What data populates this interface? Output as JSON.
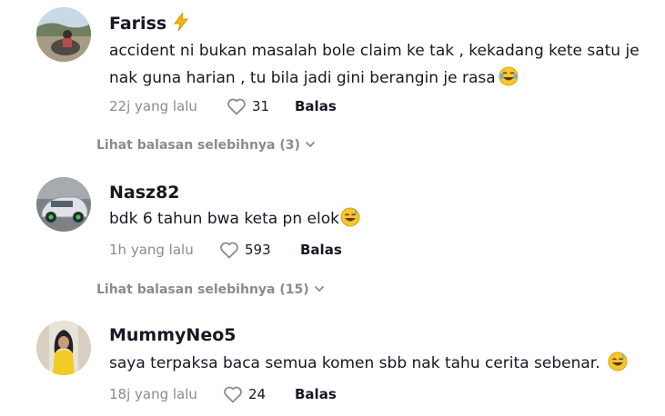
{
  "comments": [
    {
      "username": "Fariss",
      "text": "accident ni bukan masalah bole claim ke tak , kekadang kete satu je nak guna harian , tu bila jadi gini berangin je rasa",
      "time": "22j yang lalu",
      "likes": "31",
      "reply_label": "Balas",
      "more_replies": "Lihat balasan selebihnya (3)"
    },
    {
      "username": "Nasz82",
      "text": "bdk 6 tahun bwa keta pn elok",
      "time": "1h yang lalu",
      "likes": "593",
      "reply_label": "Balas",
      "more_replies": "Lihat balasan selebihnya (15)"
    },
    {
      "username": "MummyNeo5",
      "text": "saya terpaksa baca semua komen sbb nak tahu cerita sebenar.",
      "time": "18j yang lalu",
      "likes": "24",
      "reply_label": "Balas"
    }
  ],
  "icons": {
    "like": "heart-outline-icon",
    "expand": "chevron-down-icon",
    "badge": "lightning-bolt-icon"
  },
  "colors": {
    "text_primary": "#161823",
    "text_secondary": "#8a8b91",
    "emoji_yellow": "#f7c531",
    "bolt_yellow": "#f5b800"
  }
}
